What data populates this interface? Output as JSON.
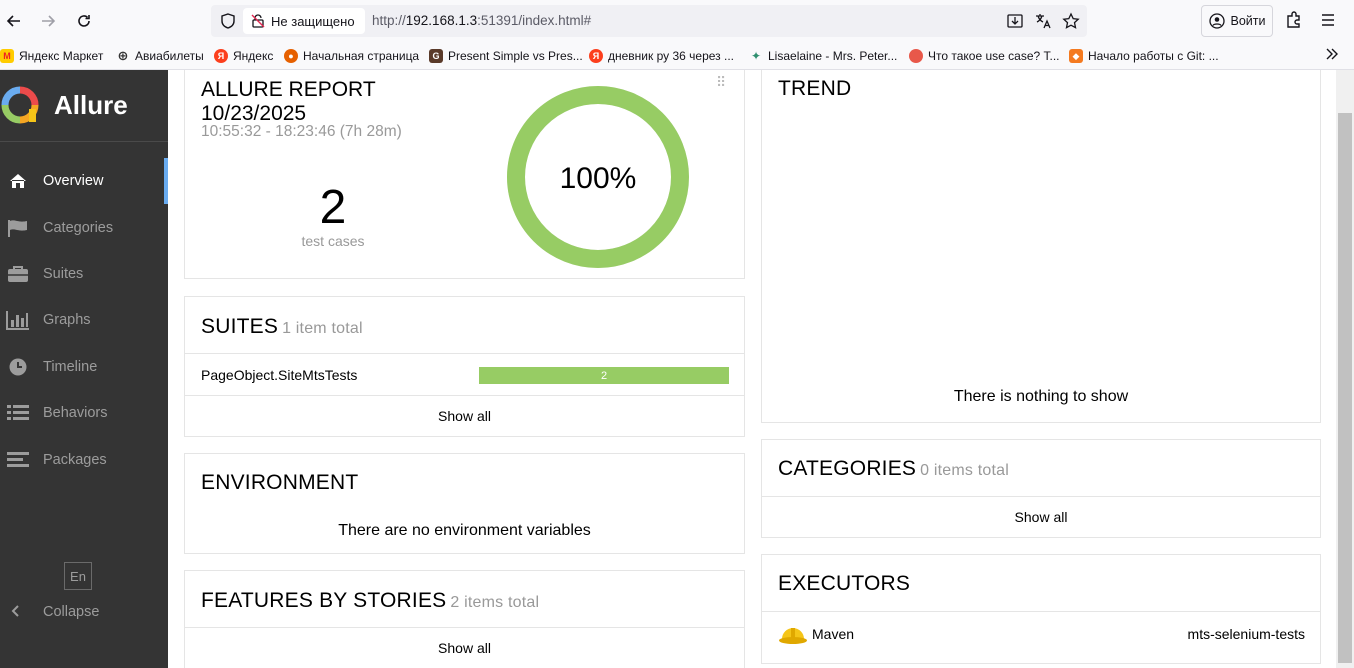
{
  "browser": {
    "not_secure_label": "Не защищено",
    "url_prefix": "http://",
    "url_host": "192.168.1.3",
    "url_rest": ":51391/index.html#",
    "login_label": "Войти",
    "bookmarks": [
      {
        "label": "Яндекс Маркет",
        "color": "#ffcc00",
        "glyph": "M"
      },
      {
        "label": "Авиабилеты",
        "color": "#333333",
        "glyph": "⊕"
      },
      {
        "label": "Яндекс",
        "color": "#fc3f1d",
        "glyph": "Я"
      },
      {
        "label": "Начальная страница",
        "color": "#e66000",
        "glyph": "●"
      },
      {
        "label": "Present Simple vs Pres...",
        "color": "#5a3a2a",
        "glyph": "G"
      },
      {
        "label": "дневник ру 36 через ...",
        "color": "#fc3f1d",
        "glyph": "Я"
      },
      {
        "label": "Lisaelaine - Mrs. Peter...",
        "color": "#2f8f6f",
        "glyph": "✦"
      },
      {
        "label": "Что такое use case? Т...",
        "color": "#e8584a",
        "glyph": "●"
      },
      {
        "label": "Начало работы с Git: ...",
        "color": "#f47a20",
        "glyph": "◆"
      }
    ]
  },
  "sidebar": {
    "brand": "Allure",
    "items": [
      {
        "label": "Overview",
        "icon": "home-icon"
      },
      {
        "label": "Categories",
        "icon": "flag-icon"
      },
      {
        "label": "Suites",
        "icon": "briefcase-icon"
      },
      {
        "label": "Graphs",
        "icon": "bar-chart-icon"
      },
      {
        "label": "Timeline",
        "icon": "clock-icon"
      },
      {
        "label": "Behaviors",
        "icon": "list-icon"
      },
      {
        "label": "Packages",
        "icon": "align-left-icon"
      }
    ],
    "language": "En",
    "collapse_label": "Collapse"
  },
  "summary": {
    "title": "ALLURE REPORT",
    "date": "10/23/2025",
    "time_range": "10:55:32 - 18:23:46 (7h 28m)",
    "test_count": "2",
    "test_count_label": "test cases",
    "percent_label": "100%",
    "passed_fraction": 1.0,
    "passed_color": "#97cc64"
  },
  "suites": {
    "title": "SUITES",
    "count": "1 item total",
    "rows": [
      {
        "name": "PageObject.SiteMtsTests",
        "passed": "2"
      }
    ],
    "show_all": "Show all"
  },
  "environment": {
    "title": "ENVIRONMENT",
    "empty": "There are no environment variables"
  },
  "features": {
    "title": "FEATURES BY STORIES",
    "count": "2 items total",
    "show_all": "Show all"
  },
  "trend": {
    "title": "TREND",
    "empty": "There is nothing to show"
  },
  "categories": {
    "title": "CATEGORIES",
    "count": "0 items total",
    "show_all": "Show all"
  },
  "executors": {
    "title": "EXECUTORS",
    "name": "Maven",
    "build": "mts-selenium-tests"
  }
}
